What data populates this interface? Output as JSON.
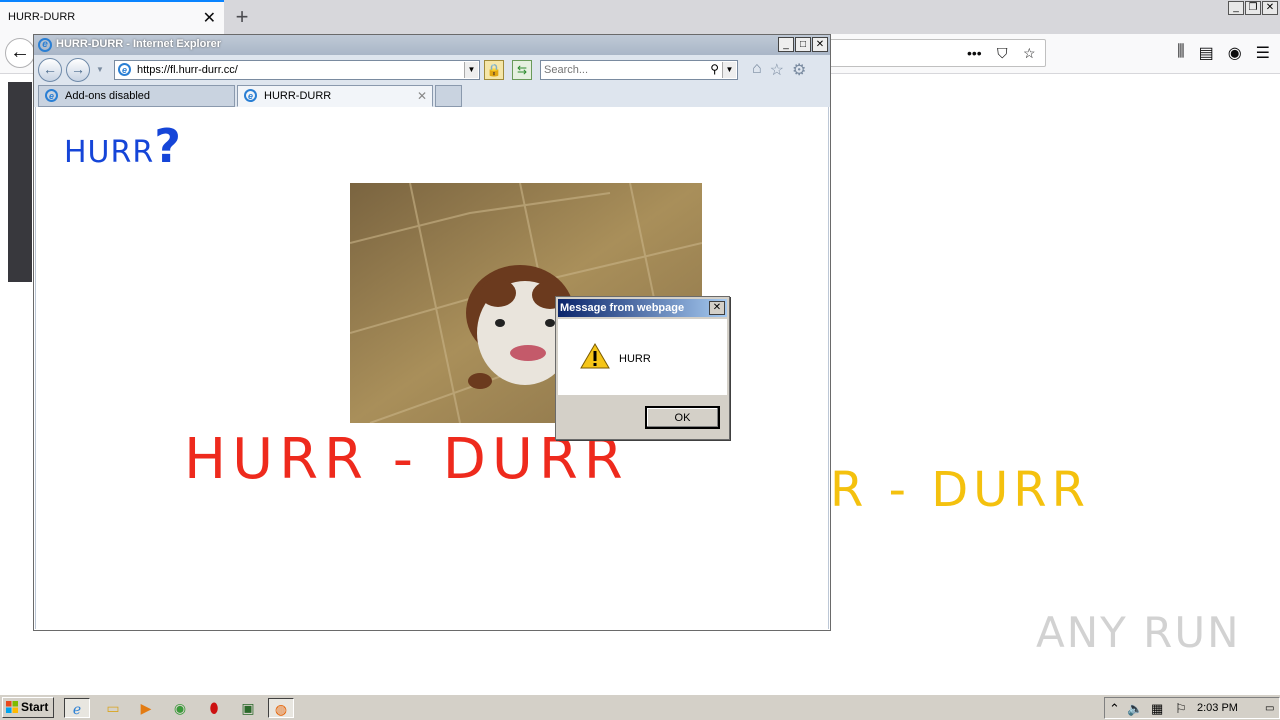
{
  "firefox": {
    "tab_title": "HURR-DURR",
    "bg_text": "R - DURR"
  },
  "ie": {
    "window_title": "HURR-DURR - Internet Explorer",
    "url": "https://fl.hurr-durr.cc/",
    "search_placeholder": "Search...",
    "tabs": [
      {
        "label": "Add-ons disabled"
      },
      {
        "label": "HURR-DURR"
      }
    ],
    "page": {
      "small_heading": "HURR",
      "small_heading_mark": "?",
      "big_text": "HURR - DURR"
    }
  },
  "dialog": {
    "title": "Message from webpage",
    "message": "HURR",
    "ok_label": "OK"
  },
  "taskbar": {
    "start_label": "Start",
    "clock": "2:03 PM"
  },
  "watermark": "ANY RUN"
}
